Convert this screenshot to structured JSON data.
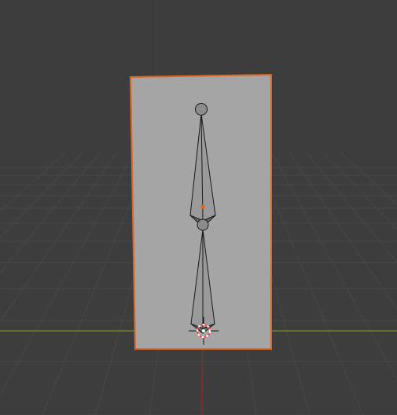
{
  "viewport": {
    "background": "#3d3d3d",
    "grid_color": "#484848",
    "x_axis_color": "#7a9a2a",
    "z_axis_color": "#8a2a2a"
  },
  "plane": {
    "fill": "#a5a5a5",
    "outline": "#e0651e",
    "selected": true
  },
  "armature": {
    "bone_count": 2,
    "bone_color": "#8f8f8f",
    "bone_outline": "#1a1a1a",
    "origin_dot_color": "#e0651e"
  },
  "cursor_3d": {
    "ring_colors": [
      "#ff4444",
      "#ffffff"
    ]
  }
}
